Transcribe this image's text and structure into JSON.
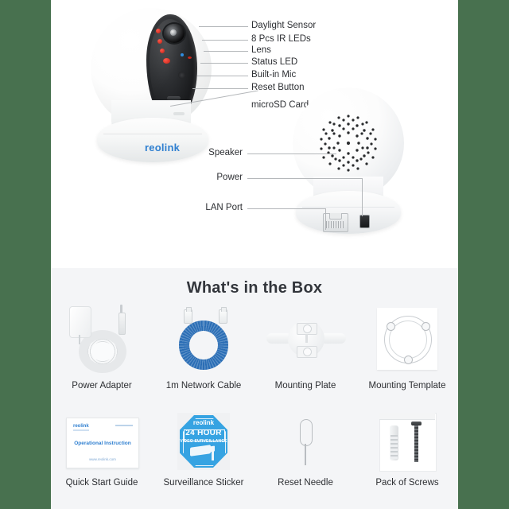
{
  "colors": {
    "page_background": "#ffffff",
    "outer_background": "#48714f",
    "box_section_background": "#f4f5f7",
    "brand_blue": "#2f7fd0",
    "sticker_blue": "#36a3e2",
    "cable_blue": "#2a6db5",
    "text": "#2d2f33",
    "leader_line": "#b4b7ba"
  },
  "diagram": {
    "front_camera": {
      "brand": "reolink",
      "callouts": [
        {
          "label": "Daylight Sensor"
        },
        {
          "label": "8 Pcs IR LEDs"
        },
        {
          "label": "Lens"
        },
        {
          "label": "Status LED"
        },
        {
          "label": "Built-in Mic"
        },
        {
          "label": "Reset Button"
        },
        {
          "label": "microSD Card Slot"
        }
      ]
    },
    "rear_camera": {
      "callouts": [
        {
          "label": "Speaker"
        },
        {
          "label": "Power"
        },
        {
          "label": "LAN Port"
        }
      ]
    }
  },
  "box_section": {
    "title": "What's in the Box",
    "items": [
      {
        "caption": "Power Adapter",
        "icon": "power-adapter-icon"
      },
      {
        "caption": "1m Network Cable",
        "icon": "network-cable-icon"
      },
      {
        "caption": "Mounting Plate",
        "icon": "mounting-plate-icon"
      },
      {
        "caption": "Mounting Template",
        "icon": "mounting-template-icon"
      },
      {
        "caption": "Quick Start Guide",
        "icon": "quick-start-guide-icon"
      },
      {
        "caption": "Surveillance Sticker",
        "icon": "surveillance-sticker-icon"
      },
      {
        "caption": "Reset Needle",
        "icon": "reset-needle-icon"
      },
      {
        "caption": "Pack of Screws",
        "icon": "screws-pack-icon"
      }
    ]
  },
  "artwork_text": {
    "guide_logo": "reolink",
    "guide_title": "Operational Instruction",
    "guide_footer": "www.reolink.com",
    "sticker_brand": "reolink",
    "sticker_headline": "24 HOUR",
    "sticker_subline": "VIDEO SURVEILLANCE"
  }
}
